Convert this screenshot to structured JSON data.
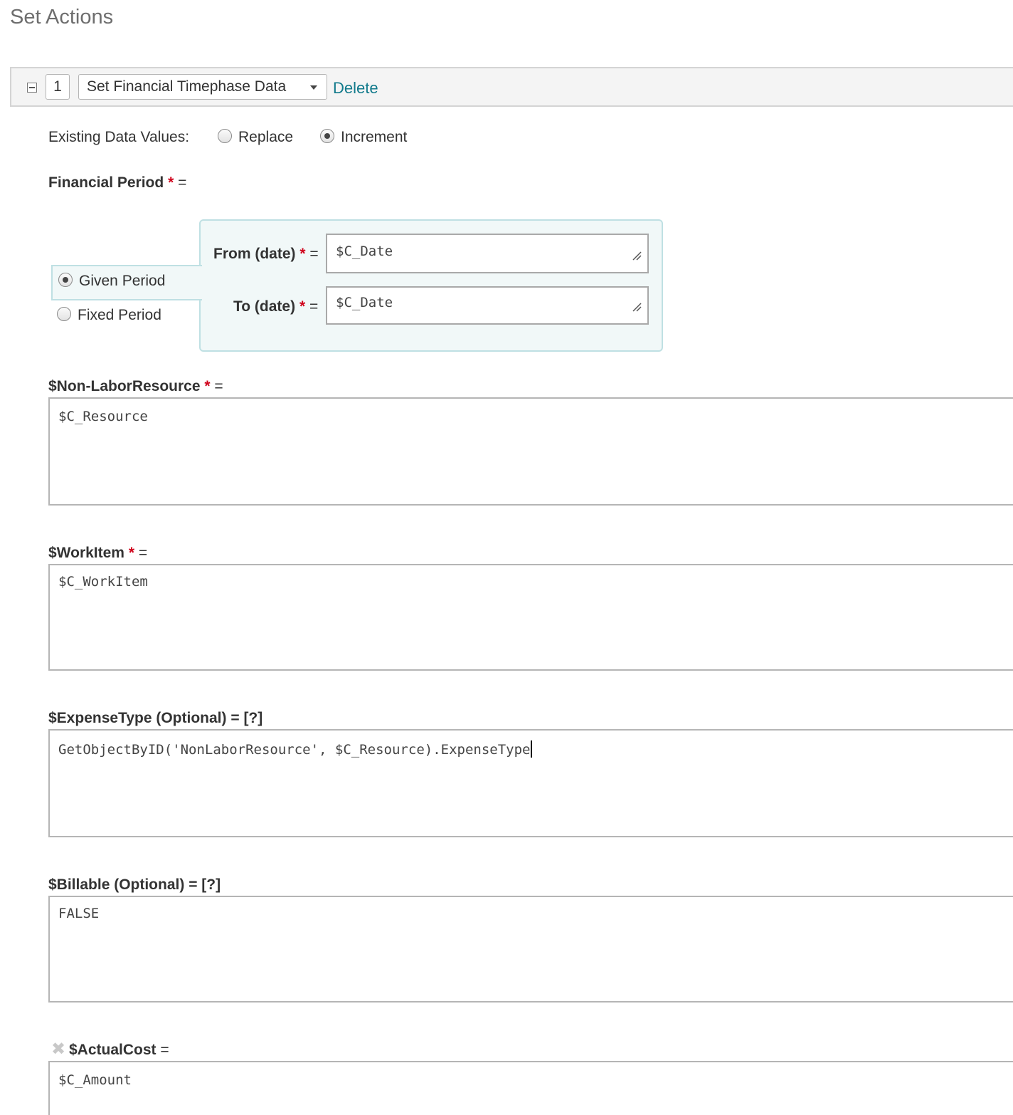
{
  "page": {
    "title": "Set Actions"
  },
  "action": {
    "order": "1",
    "type_selected": "Set Financial Timephase Data",
    "delete_label": "Delete"
  },
  "existing_values": {
    "label": "Existing Data Values:",
    "options": [
      "Replace",
      "Increment"
    ],
    "selected": "Increment"
  },
  "financial_period": {
    "label": "Financial Period",
    "required_mark": "*",
    "equals": "=",
    "options": [
      "Given Period",
      "Fixed Period"
    ],
    "selected": "Given Period",
    "from_label": "From (date)",
    "from_value": "$C_Date",
    "to_label": "To (date)",
    "to_value": "$C_Date"
  },
  "fields": [
    {
      "label": "$Non-LaborResource",
      "required": true,
      "suffix": "=",
      "value": "$C_Resource"
    },
    {
      "label": "$WorkItem",
      "required": true,
      "suffix": "=",
      "value": "$C_WorkItem"
    },
    {
      "label": "$ExpenseType (Optional)",
      "required": false,
      "suffix": "= [?]",
      "value": "GetObjectByID('NonLaborResource', $C_Resource).ExpenseType"
    },
    {
      "label": "$Billable (Optional)",
      "required": false,
      "suffix": "= [?]",
      "value": "FALSE"
    },
    {
      "label": "$ActualCost",
      "required": false,
      "suffix": "=",
      "value": "$C_Amount"
    }
  ],
  "colors": {
    "link": "#117a8b",
    "required": "#d0021b",
    "panel_bg": "#f1f8f8",
    "panel_border": "#bfe0e3"
  }
}
